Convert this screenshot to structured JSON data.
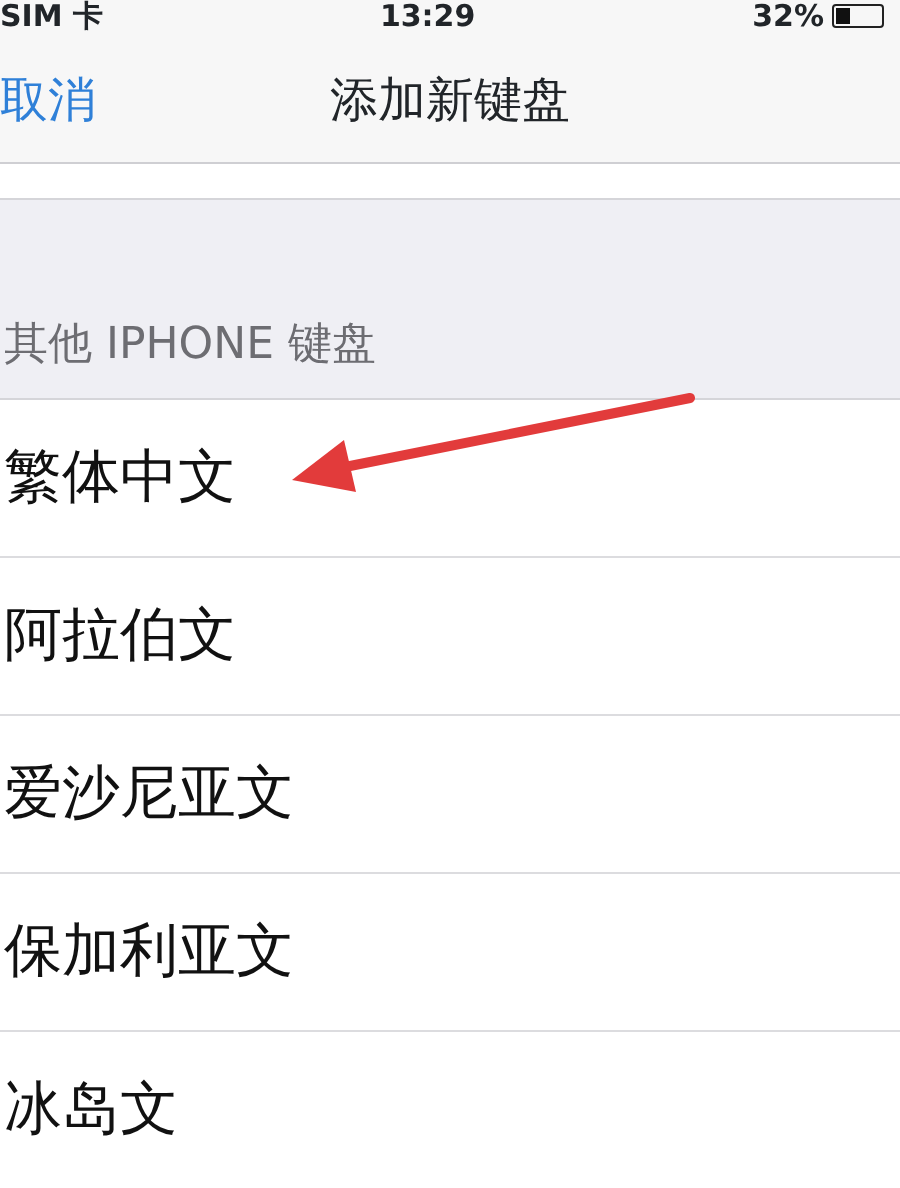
{
  "status_bar": {
    "carrier": "SIM 卡",
    "time": "13:29",
    "battery": "32%"
  },
  "nav_bar": {
    "cancel": "取消",
    "title": "添加新键盘"
  },
  "section": {
    "header": "其他 IPHONE 键盘",
    "items": [
      {
        "label": "繁体中文"
      },
      {
        "label": "阿拉伯文"
      },
      {
        "label": "爱沙尼亚文"
      },
      {
        "label": "保加利亚文"
      },
      {
        "label": "冰岛文"
      }
    ]
  }
}
